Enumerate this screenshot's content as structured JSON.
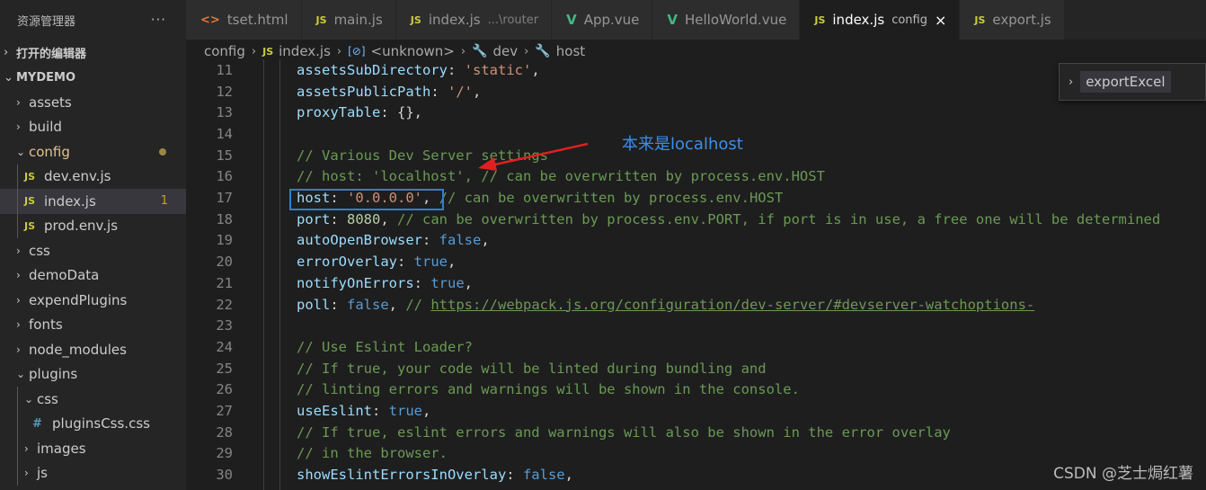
{
  "sidebar": {
    "title": "资源管理器",
    "more": "···",
    "open_editors": "打开的编辑器",
    "project": "MYDEMO",
    "items": [
      {
        "label": "assets",
        "chev": "›",
        "depth": 0
      },
      {
        "label": "build",
        "chev": "›",
        "depth": 0
      },
      {
        "label": "config",
        "chev": "⌄",
        "depth": 0
      },
      {
        "label": "dev.env.js",
        "depth": 1,
        "type": "js"
      },
      {
        "label": "index.js",
        "depth": 1,
        "type": "js",
        "badge": "1"
      },
      {
        "label": "prod.env.js",
        "depth": 1,
        "type": "js"
      },
      {
        "label": "css",
        "chev": "›",
        "depth": 0
      },
      {
        "label": "demoData",
        "chev": "›",
        "depth": 0
      },
      {
        "label": "expendPlugins",
        "chev": "›",
        "depth": 0
      },
      {
        "label": "fonts",
        "chev": "›",
        "depth": 0
      },
      {
        "label": "node_modules",
        "chev": "›",
        "depth": 0
      },
      {
        "label": "plugins",
        "chev": "⌄",
        "depth": 0
      },
      {
        "label": "css",
        "chev": "⌄",
        "depth": 1
      },
      {
        "label": "pluginsCss.css",
        "depth": 2,
        "type": "css"
      },
      {
        "label": "images",
        "chev": "›",
        "depth": 1
      },
      {
        "label": "js",
        "chev": "›",
        "depth": 1
      }
    ]
  },
  "tabs": [
    {
      "label": "tset.html",
      "icon": "<>",
      "type": "html"
    },
    {
      "label": "main.js",
      "icon": "JS",
      "type": "js"
    },
    {
      "label": "index.js",
      "sub": "...\\router",
      "icon": "JS",
      "type": "js"
    },
    {
      "label": "App.vue",
      "icon": "V",
      "type": "vue"
    },
    {
      "label": "HelloWorld.vue",
      "icon": "V",
      "type": "vue"
    },
    {
      "label": "index.js",
      "sub": "config",
      "icon": "JS",
      "type": "js",
      "active": true
    },
    {
      "label": "export.js",
      "icon": "JS",
      "type": "js"
    }
  ],
  "tab_close": "×",
  "breadcrumb": {
    "folder": "config",
    "file_icon": "JS",
    "file": "index.js",
    "symbol_icon": "[⊘]",
    "symbol": "<unknown>",
    "prop1": "dev",
    "prop2": "host",
    "sep": "›",
    "wrench": "🔧"
  },
  "code": {
    "line_numbers": [
      "11",
      "12",
      "13",
      "14",
      "15",
      "16",
      "17",
      "18",
      "19",
      "20",
      "21",
      "22",
      "23",
      "24",
      "25",
      "26",
      "27",
      "28",
      "29",
      "30"
    ],
    "l11": {
      "prop": "assetsSubDirectory",
      "colon": ": ",
      "str": "'static'",
      "end": ","
    },
    "l12": {
      "prop": "assetsPublicPath",
      "colon": ": ",
      "str": "'/'",
      "end": ","
    },
    "l13": {
      "prop": "proxyTable",
      "colon": ": ",
      "rest": "{},"
    },
    "l15": "// Various Dev Server settings",
    "l16": "// host: 'localhost', // can be overwritten by process.env.HOST",
    "l17": {
      "prop": "host",
      "colon": ": ",
      "str": "'0.0.0.0'",
      "end": ", ",
      "cm": "// can be overwritten by process.env.HOST"
    },
    "l18": {
      "prop": "port",
      "colon": ": ",
      "num": "8080",
      "end": ", ",
      "cm": "// can be overwritten by process.env.PORT, if port is in use, a free one will be determined"
    },
    "l19": {
      "prop": "autoOpenBrowser",
      "colon": ": ",
      "kw": "false",
      "end": ","
    },
    "l20": {
      "prop": "errorOverlay",
      "colon": ": ",
      "kw": "true",
      "end": ","
    },
    "l21": {
      "prop": "notifyOnErrors",
      "colon": ": ",
      "kw": "true",
      "end": ","
    },
    "l22": {
      "prop": "poll",
      "colon": ": ",
      "kw": "false",
      "end": ", ",
      "cm": "// ",
      "link": "https://webpack.js.org/configuration/dev-server/#devserver-watchoptions-"
    },
    "l24": "// Use Eslint Loader?",
    "l25": "// If true, your code will be linted during bundling and",
    "l26": "// linting errors and warnings will be shown in the console.",
    "l27": {
      "prop": "useEslint",
      "colon": ": ",
      "kw": "true",
      "end": ","
    },
    "l28": "// If true, eslint errors and warnings will also be shown in the error overlay",
    "l29": "// in the browser.",
    "l30": {
      "prop": "showEslintErrorsInOverlay",
      "colon": ": ",
      "kw": "false",
      "end": ","
    }
  },
  "annotation": "本来是localhost",
  "outline_popup": {
    "chev": "›",
    "item": "exportExcel"
  },
  "watermark": "CSDN @芝士焗红薯",
  "colors": {
    "highlight_box": "#2f7fd0",
    "annotation_arrow": "#e02020",
    "annotation_text": "#3c8fe8"
  }
}
